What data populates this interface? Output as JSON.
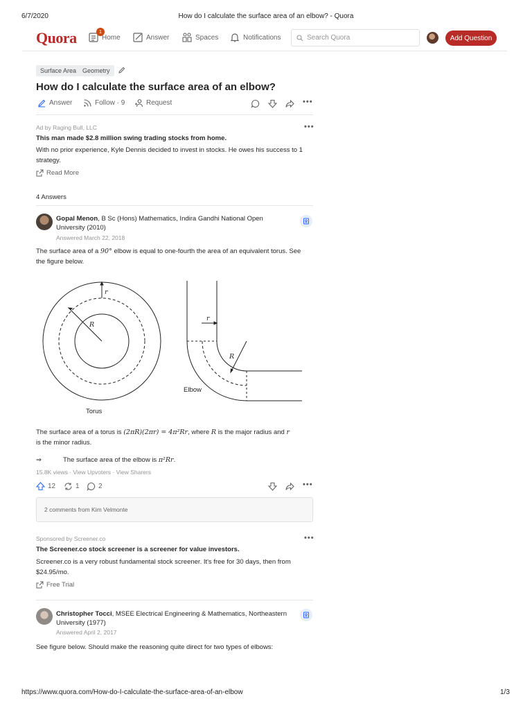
{
  "print": {
    "date": "6/7/2020",
    "page_title": "How do I calculate the surface area of an elbow? - Quora",
    "url": "https://www.quora.com/How-do-I-calculate-the-surface-area-of-an-elbow",
    "page_num": "1/3"
  },
  "header": {
    "logo": "Quora",
    "nav": {
      "home": "Home",
      "home_badge": "1",
      "answer": "Answer",
      "spaces": "Spaces",
      "notifications": "Notifications"
    },
    "search_placeholder": "Search Quora",
    "add_question": "Add Question"
  },
  "question": {
    "tags": [
      "Surface Area",
      "Geometry"
    ],
    "title": "How do I calculate the surface area of an elbow?",
    "actions": {
      "answer": "Answer",
      "follow": "Follow · 9",
      "request": "Request"
    }
  },
  "ad1": {
    "by": "Ad by Raging Bull, LLC",
    "title": "This man made $2.8 million swing trading stocks from home.",
    "body": "With no prior experience, Kyle Dennis decided to invest in stocks. He owes his success to 1 strategy.",
    "link": "Read More"
  },
  "answers_count": "4 Answers",
  "answer1": {
    "author": "Gopal Menon",
    "credential_l1": ", B Sc (Hons) Mathematics, Indira Gandhi National Open",
    "credential_l2": "University (2010)",
    "date": "Answered March 22, 2018",
    "p1_a": "The surface area of a",
    "p1_math": "90°",
    "p1_b": "elbow is equal to one-fourth the area of an equivalent torus. See",
    "p1_c": "the figure below.",
    "fig": {
      "r_label": "r",
      "R_label": "R",
      "torus_label": "Torus",
      "elbow_label": "Elbow"
    },
    "p2_a": "The surface area of a torus is",
    "p2_math": "(2πR)(2πr) = 4π²Rr",
    "p2_b": ", where",
    "p2_R": "R",
    "p2_c": "is the major radius and",
    "p2_r": "r",
    "p2_d": "is the minor radius.",
    "p3_arrow": "⇒",
    "p3_a": "The surface area of the elbow is",
    "p3_math": "π²Rr",
    "p3_end": ".",
    "stats": "15.8K views · View Upvoters · View Sharers",
    "upvotes": "12",
    "shares": "1",
    "comments": "2",
    "comments_box": "2 comments from Kim Velmonte"
  },
  "ad2": {
    "by": "Sponsored by Screener.co",
    "title": "The Screener.co stock screener is a screener for value investors.",
    "body_l1": "Screener.co is a very robust fundamental stock screener. It's free for 30 days, then from",
    "body_l2": "$24.95/mo.",
    "link": "Free Trial"
  },
  "answer2": {
    "author": "Christopher Tocci",
    "credential_l1": ", MSEE Electrical Engineering & Mathematics, Northeastern",
    "credential_l2": "University (1977)",
    "date": "Answered April 2, 2017",
    "p1": "See figure below. Should make the reasoning quite direct for two types of elbows:"
  }
}
